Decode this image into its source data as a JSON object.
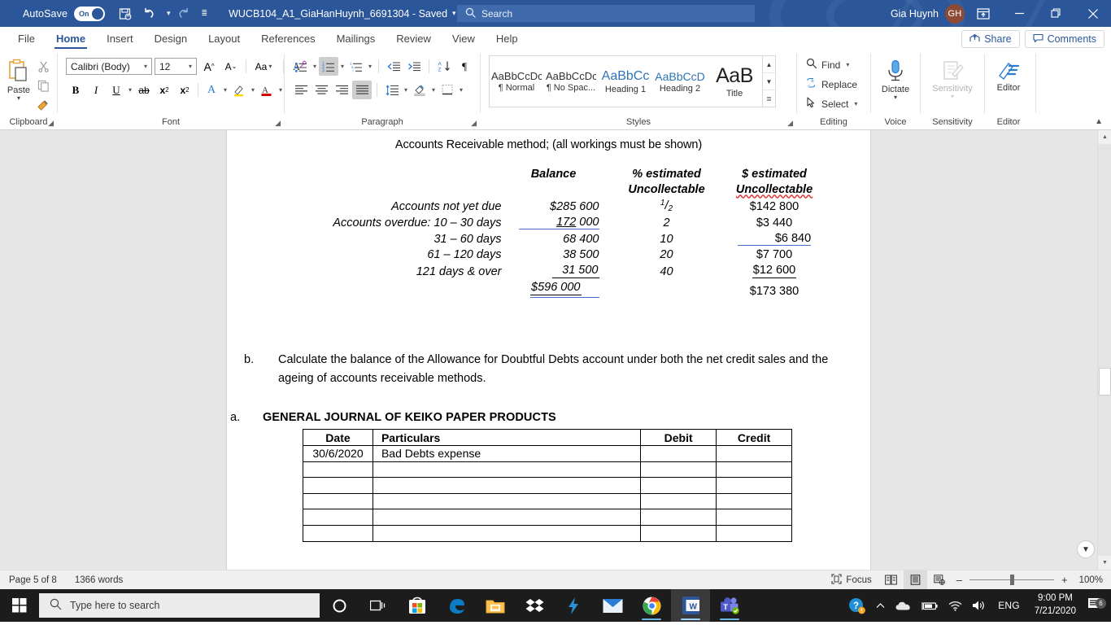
{
  "titlebar": {
    "autosave_label": "AutoSave",
    "autosave_state": "On",
    "document_title": "WUCB104_A1_GiaHanHuynh_6691304  -  Saved",
    "search_placeholder": "Search",
    "user_name": "Gia Huynh",
    "user_initials": "GH",
    "quick_access": [
      "save-icon",
      "undo-icon",
      "redo-icon",
      "customize-qat-icon"
    ],
    "window_buttons": [
      "ribbon-display-options-icon",
      "minimize-icon",
      "restore-icon",
      "close-icon"
    ]
  },
  "ribbon_tabs": {
    "items": [
      "File",
      "Home",
      "Insert",
      "Design",
      "Layout",
      "References",
      "Mailings",
      "Review",
      "View",
      "Help"
    ],
    "active": "Home",
    "share_label": "Share",
    "comments_label": "Comments"
  },
  "ribbon": {
    "clipboard": {
      "group_label": "Clipboard",
      "paste_label": "Paste"
    },
    "font": {
      "group_label": "Font",
      "font_family": "Calibri (Body)",
      "font_size": "12",
      "buttons": [
        "grow-font-icon",
        "shrink-font-icon",
        "change-case-icon",
        "clear-formatting-icon",
        "bold-icon",
        "italic-icon",
        "underline-icon",
        "strikethrough-icon",
        "subscript-icon",
        "superscript-icon",
        "text-effects-icon",
        "text-highlight-icon",
        "font-color-icon"
      ]
    },
    "paragraph": {
      "group_label": "Paragraph",
      "buttons": [
        "bullets-icon",
        "numbering-icon",
        "multilevel-list-icon",
        "decrease-indent-icon",
        "increase-indent-icon",
        "sort-icon",
        "show-formatting-marks-icon",
        "align-left-icon",
        "align-center-icon",
        "align-right-icon",
        "justify-icon",
        "line-spacing-icon",
        "shading-icon",
        "borders-icon"
      ]
    },
    "styles": {
      "group_label": "Styles",
      "items": [
        {
          "preview": "AaBbCcDc",
          "name": "¶ Normal",
          "kind": "normal"
        },
        {
          "preview": "AaBbCcDc",
          "name": "¶ No Spac...",
          "kind": "normal"
        },
        {
          "preview": "AaBbCс",
          "name": "Heading 1",
          "kind": "h1"
        },
        {
          "preview": "AaBbCcD",
          "name": "Heading 2",
          "kind": "h2"
        },
        {
          "preview": "AaB",
          "name": "Title",
          "kind": "title"
        }
      ]
    },
    "editing": {
      "group_label": "Editing",
      "find_label": "Find",
      "replace_label": "Replace",
      "select_label": "Select"
    },
    "voice": {
      "group_label": "Voice",
      "dictate_label": "Dictate"
    },
    "sensitivity": {
      "group_label": "Sensitivity",
      "button_label": "Sensitivity"
    },
    "editor": {
      "group_label": "Editor",
      "button_label": "Editor"
    }
  },
  "document": {
    "heading_line": "Accounts Receivable method; (all workings must be shown)",
    "aging_table": {
      "headers": {
        "balance": "Balance",
        "pct_line1": "% estimated",
        "pct_line2": "Uncollectable",
        "amt_line1": "$ estimated",
        "amt_line2": "Uncollectable"
      },
      "rows": [
        {
          "label": "Accounts not yet due",
          "balance": "$285 600",
          "pct": "1/2",
          "amount": "$142 800"
        },
        {
          "label": "Accounts overdue: 10 – 30 days",
          "balance": "172 000",
          "pct": "2",
          "amount": "$3 440"
        },
        {
          "label": "31 – 60 days",
          "balance": "68 400",
          "pct": "10",
          "amount": "$6 840"
        },
        {
          "label": "61 – 120 days",
          "balance": "38 500",
          "pct": "20",
          "amount": "$7 700"
        },
        {
          "label": "121 days & over",
          "balance": "31 500",
          "pct": "40",
          "amount": "$12 600"
        }
      ],
      "total": {
        "balance": "$596 000",
        "amount": "$173 380"
      }
    },
    "question_b": {
      "marker": "b.",
      "text": "Calculate the balance of the Allowance for Doubtful Debts account under both the net credit sales and the ageing of accounts receivable methods."
    },
    "question_a": {
      "marker": "a.",
      "title": "GENERAL JOURNAL OF KEIKO PAPER PRODUCTS"
    },
    "journal": {
      "columns": [
        "Date",
        "Particulars",
        "Debit",
        "Credit"
      ],
      "rows": [
        [
          "30/6/2020",
          "Bad Debts expense",
          "",
          ""
        ],
        [
          "",
          "",
          "",
          ""
        ],
        [
          "",
          "",
          "",
          ""
        ],
        [
          "",
          "",
          "",
          ""
        ],
        [
          "",
          "",
          "",
          ""
        ],
        [
          "",
          "",
          "",
          ""
        ]
      ]
    }
  },
  "statusbar": {
    "page_label": "Page 5 of 8",
    "word_count": "1366 words",
    "focus_label": "Focus",
    "view_buttons": [
      "read-mode-icon",
      "print-layout-icon",
      "web-layout-icon"
    ],
    "zoom_out": "–",
    "zoom_in": "+",
    "zoom_level": "100%"
  },
  "taskbar": {
    "search_placeholder": "Type here to search",
    "icons": [
      "cortana-icon",
      "task-view-icon",
      "microsoft-store-icon",
      "edge-icon",
      "file-explorer-icon",
      "dropbox-icon",
      "lightshot-icon",
      "mail-icon",
      "chrome-icon",
      "word-icon",
      "teams-icon"
    ],
    "tray_icons": [
      "help-icon",
      "show-hidden-icons-icon",
      "onedrive-icon",
      "battery-icon",
      "wifi-icon",
      "volume-icon"
    ],
    "language": "ENG",
    "time": "9:00 PM",
    "date": "7/21/2020",
    "notification_count": "6"
  },
  "colors": {
    "word_blue": "#2b579a",
    "accent_blue": "#4472c4",
    "heading_blue": "#2e74b5",
    "taskbar": "#1c1c1c"
  }
}
